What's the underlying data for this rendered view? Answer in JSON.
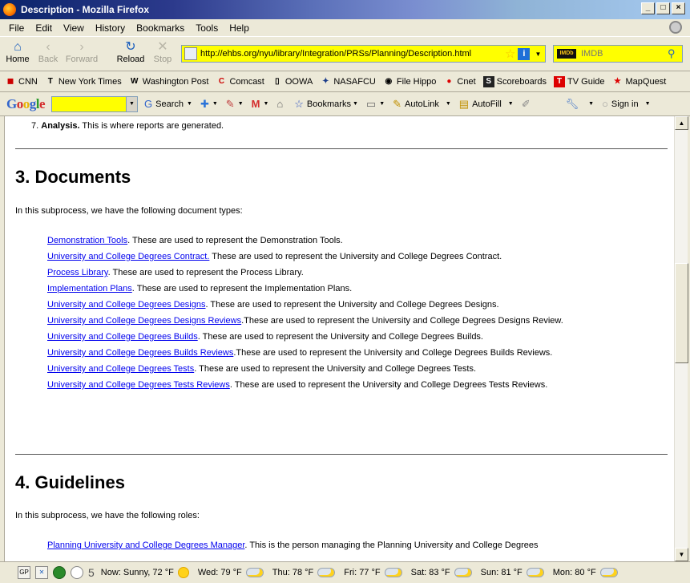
{
  "window": {
    "title": "Description - Mozilla Firefox"
  },
  "menus": [
    "File",
    "Edit",
    "View",
    "History",
    "Bookmarks",
    "Tools",
    "Help"
  ],
  "nav": {
    "home": "Home",
    "back": "Back",
    "forward": "Forward",
    "reload": "Reload",
    "stop": "Stop",
    "url": "http://ehbs.org/nyu/library/Integration/PRSs/Planning/Description.html",
    "search_engine": "IMDb",
    "search_placeholder": "IMDB"
  },
  "bookmarks": [
    {
      "label": "CNN",
      "icon": "cnn-icon"
    },
    {
      "label": "New York Times",
      "icon": "nyt-icon"
    },
    {
      "label": "Washington Post",
      "icon": "wapo-icon"
    },
    {
      "label": "Comcast",
      "icon": "comcast-icon"
    },
    {
      "label": "OOWA",
      "icon": "page-icon"
    },
    {
      "label": "NASAFCU",
      "icon": "nasafcu-icon"
    },
    {
      "label": "File Hippo",
      "icon": "filehippo-icon"
    },
    {
      "label": "Cnet",
      "icon": "cnet-icon"
    },
    {
      "label": "Scoreboards",
      "icon": "si-icon"
    },
    {
      "label": "TV Guide",
      "icon": "tvguide-icon"
    },
    {
      "label": "MapQuest",
      "icon": "mapquest-icon"
    }
  ],
  "google_toolbar": {
    "logo": "Google",
    "search": "Search",
    "bookmarks": "Bookmarks",
    "autolink": "AutoLink",
    "autofill": "AutoFill",
    "signin": "Sign in"
  },
  "content": {
    "list_item_7": {
      "num": "7.",
      "bold": "Analysis.",
      "text": " This is where reports are generated."
    },
    "section3": {
      "title": "3. Documents",
      "intro": "In this subprocess, we have the following document types:",
      "documents": [
        {
          "link": "Demonstration Tools",
          "desc": ". These are used to represent the Demonstration Tools."
        },
        {
          "link": "University and College Degrees Contract.",
          "desc": " These are used to represent the University and College Degrees Contract."
        },
        {
          "link": "Process Library",
          "desc": ". These are used to represent the Process Library."
        },
        {
          "link": "Implementation Plans",
          "desc": ". These are used to represent the Implementation Plans."
        },
        {
          "link": "University and College Degrees Designs",
          "desc": ". These are used to represent the University and College Degrees Designs."
        },
        {
          "link": "University and College Degrees Designs Reviews",
          "desc": ".These are used to represent the University and College Degrees Designs Review."
        },
        {
          "link": "University and College Degrees Builds",
          "desc": ". These are used to represent the University and College Degrees Builds."
        },
        {
          "link": "University and College Degrees Builds Reviews",
          "desc": ".These are used to represent the University and College Degrees Builds Reviews."
        },
        {
          "link": "University and College Degrees Tests",
          "desc": ". These are used to represent the University and College Degrees Tests."
        },
        {
          "link": "University and College Degrees Tests Reviews",
          "desc": ". These are used to represent the University and College Degrees Tests Reviews."
        }
      ]
    },
    "section4": {
      "title": "4. Guidelines",
      "intro": "In this subprocess, we have the following roles:",
      "role_link": "Planning University and College Degrees Manager",
      "role_desc": ". This is the person managing the Planning University and College Degrees"
    }
  },
  "statusbar": {
    "count": "5",
    "weather": [
      {
        "label": "Now: Sunny, 72 °F",
        "icon": "sun-icon"
      },
      {
        "label": "Wed: 79 °F",
        "icon": "partly-cloudy-icon"
      },
      {
        "label": "Thu: 78 °F",
        "icon": "partly-cloudy-icon"
      },
      {
        "label": "Fri: 77 °F",
        "icon": "partly-cloudy-icon"
      },
      {
        "label": "Sat: 83 °F",
        "icon": "partly-cloudy-icon"
      },
      {
        "label": "Sun: 81 °F",
        "icon": "partly-cloudy-icon"
      },
      {
        "label": "Mon: 80 °F",
        "icon": "partly-cloudy-icon"
      }
    ]
  }
}
